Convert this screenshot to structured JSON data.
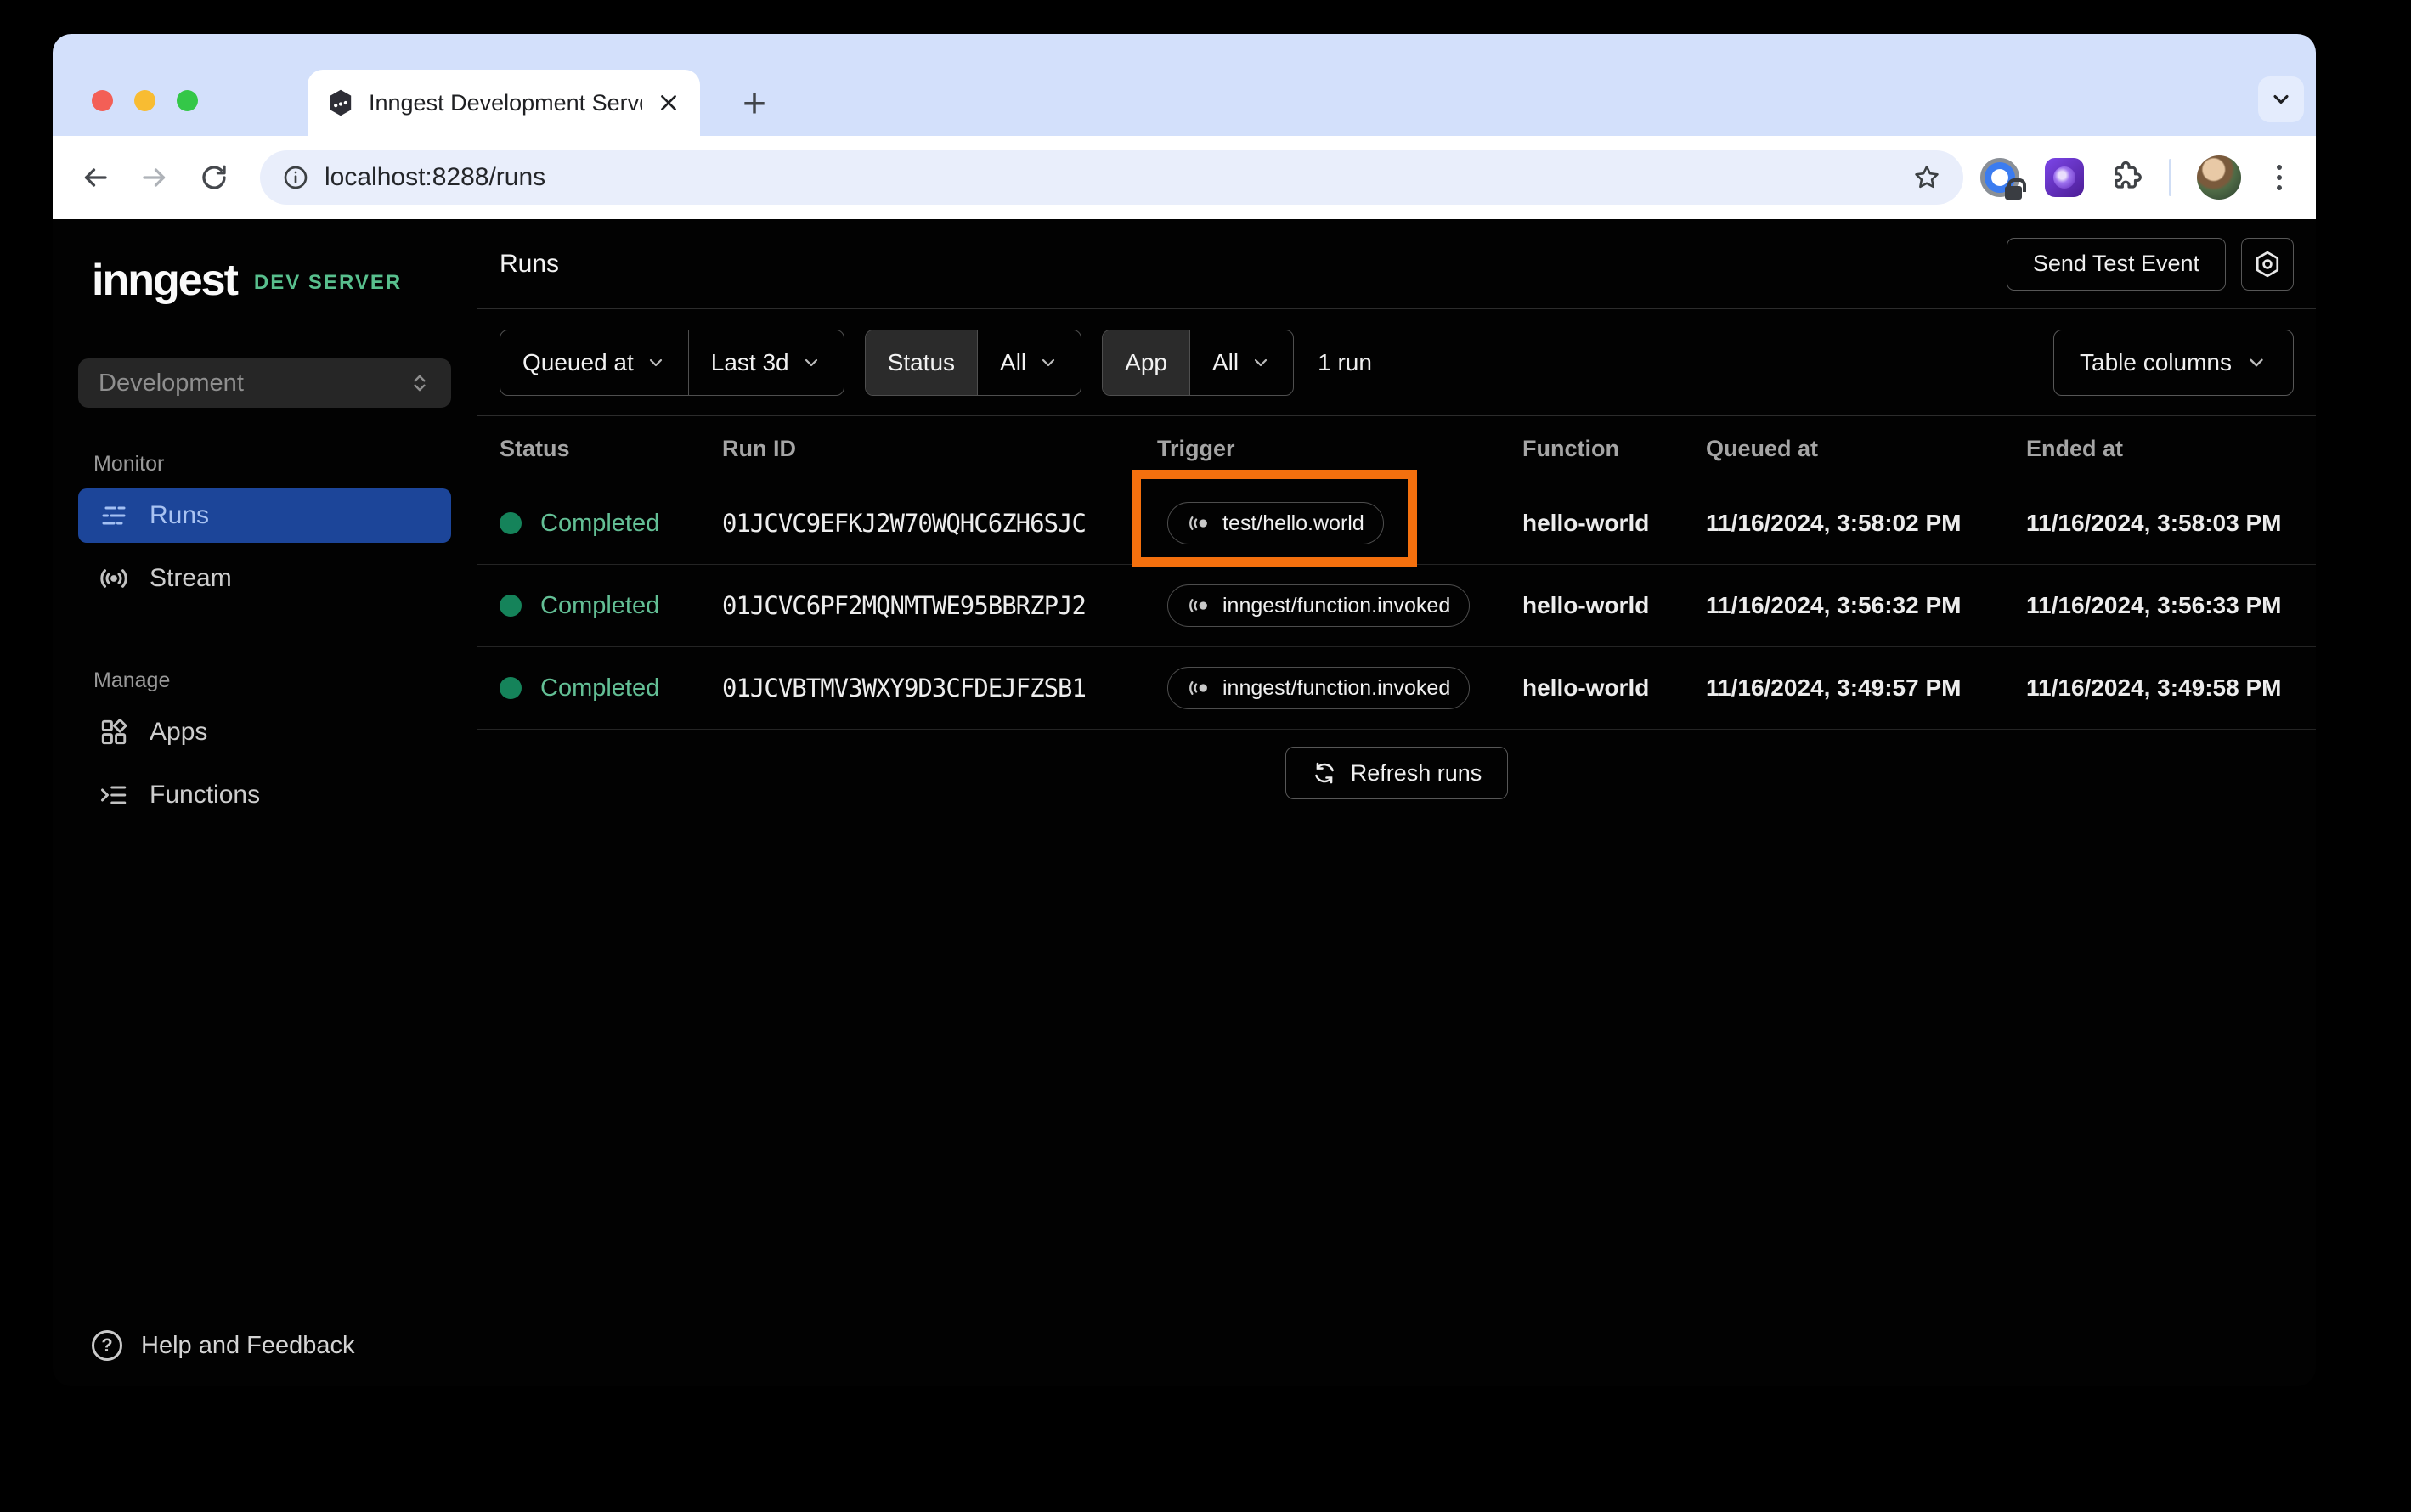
{
  "browser": {
    "tab_title": "Inngest Development Server",
    "url": "localhost:8288/runs"
  },
  "sidebar": {
    "logo": "inngest",
    "logo_badge": "DEV SERVER",
    "env_select": "Development",
    "monitor_label": "Monitor",
    "manage_label": "Manage",
    "items": {
      "runs": "Runs",
      "stream": "Stream",
      "apps": "Apps",
      "functions": "Functions"
    },
    "help": "Help and Feedback"
  },
  "header": {
    "title": "Runs",
    "send_test_event": "Send Test Event"
  },
  "filters": {
    "queued_at": "Queued at",
    "range": "Last 3d",
    "status_label": "Status",
    "status_value": "All",
    "app_label": "App",
    "app_value": "All",
    "count": "1 run",
    "table_columns": "Table columns"
  },
  "table": {
    "columns": [
      "Status",
      "Run ID",
      "Trigger",
      "Function",
      "Queued at",
      "Ended at"
    ],
    "rows": [
      {
        "status": "Completed",
        "run_id": "01JCVC9EFKJ2W70WQHC6ZH6SJC",
        "trigger": "test/hello.world",
        "function": "hello-world",
        "queued_at": "11/16/2024, 3:58:02 PM",
        "ended_at": "11/16/2024, 3:58:03 PM",
        "highlighted": true
      },
      {
        "status": "Completed",
        "run_id": "01JCVC6PF2MQNMTWE95BBRZPJ2",
        "trigger": "inngest/function.invoked",
        "function": "hello-world",
        "queued_at": "11/16/2024, 3:56:32 PM",
        "ended_at": "11/16/2024, 3:56:33 PM",
        "highlighted": false
      },
      {
        "status": "Completed",
        "run_id": "01JCVBTMV3WXY9D3CFDEJFZSB1",
        "trigger": "inngest/function.invoked",
        "function": "hello-world",
        "queued_at": "11/16/2024, 3:49:57 PM",
        "ended_at": "11/16/2024, 3:49:58 PM",
        "highlighted": false
      }
    ],
    "refresh": "Refresh runs"
  },
  "colors": {
    "active_nav_blue": "#1c4599",
    "status_dot_green": "#15835a",
    "status_text_green": "#63bf95",
    "dev_badge_green": "#58bf8d",
    "annotation_orange": "#f4700e",
    "tabstrip_blue": "#d3e0fb"
  }
}
